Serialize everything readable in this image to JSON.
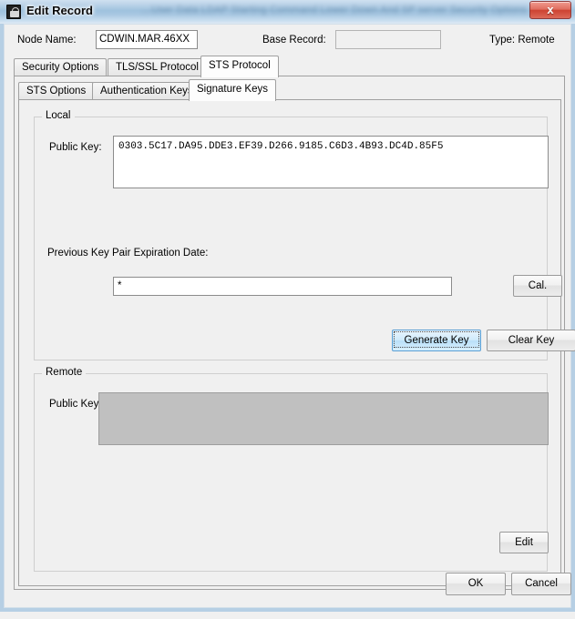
{
  "window": {
    "title": "Edit Record",
    "icon": "lock-icon",
    "close_label": "x",
    "glass_background_text": "…User Data LDAP Starting Command Lower Down  And SP server Security Options"
  },
  "header": {
    "node_name_label": "Node Name:",
    "node_name_value": "CDWIN.MAR.46XX",
    "base_record_label": "Base Record:",
    "base_record_value": "",
    "type_label": "Type: Remote"
  },
  "tabs_outer": {
    "items": [
      {
        "label": "Security Options",
        "active": false
      },
      {
        "label": "TLS/SSL Protocol",
        "active": false
      },
      {
        "label": "STS Protocol",
        "active": true
      }
    ]
  },
  "tabs_inner": {
    "items": [
      {
        "label": "STS Options",
        "active": false
      },
      {
        "label": "Authentication Keys",
        "active": false
      },
      {
        "label": "Signature Keys",
        "active": true
      }
    ]
  },
  "local": {
    "group_title": "Local",
    "public_key_label": "Public Key:",
    "public_key_value": "0303.5C17.DA95.DDE3.EF39.D266.9185.C6D3.4B93.DC4D.85F5",
    "expiration_label": "Previous Key Pair Expiration Date:",
    "expiration_value": "*",
    "cal_button": "Cal.",
    "generate_key_button": "Generate Key",
    "clear_key_button": "Clear Key"
  },
  "remote": {
    "group_title": "Remote",
    "public_key_label": "Public Key:",
    "public_key_value": "",
    "edit_button": "Edit"
  },
  "footer": {
    "ok_label": "OK",
    "cancel_label": "Cancel"
  },
  "colors": {
    "window_bg": "#f0f0f0",
    "titlebar_glass": "#9fc2de",
    "frame_border": "#b6cfe4",
    "close_red": "#cd4231",
    "focus_blue": "#b9dff8",
    "disabled_gray": "#c0c0c0"
  }
}
